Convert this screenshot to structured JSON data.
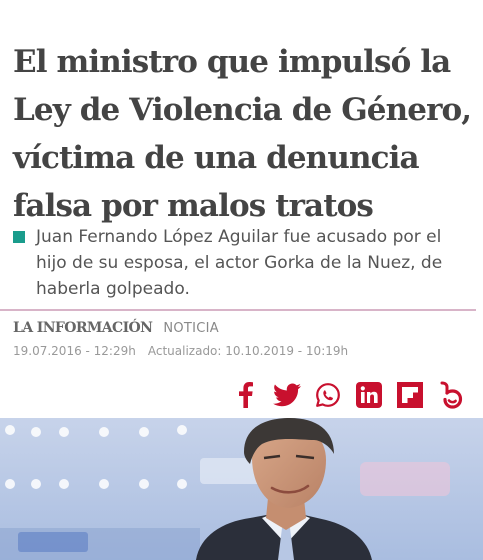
{
  "article": {
    "headline_lines": [
      "El ministro que impulsó la",
      "Ley de Violencia de Género,",
      "víctima de una denuncia",
      "falsa por malos tratos"
    ],
    "summary": "Juan Fernando López Aguilar fue acusado por el hijo de su esposa, el actor Gorka de la Nuez, de haberla golpeado.",
    "source": "LA INFORMACIÓN",
    "section": "NOTICIA",
    "published": "19.07.2016 - 12:29h",
    "updated": "Actualizado: 10.10.2019 - 10:19h"
  },
  "share": {
    "buttons": [
      {
        "name": "facebook",
        "icon": "facebook-icon"
      },
      {
        "name": "twitter",
        "icon": "twitter-icon"
      },
      {
        "name": "whatsapp",
        "icon": "whatsapp-icon"
      },
      {
        "name": "linkedin",
        "icon": "linkedin-icon"
      },
      {
        "name": "flipboard",
        "icon": "flipboard-icon"
      },
      {
        "name": "meneame",
        "icon": "meneame-icon"
      }
    ]
  },
  "colors": {
    "headline": "#444444",
    "accent": "#1a9c8c",
    "divider": "#d8b4c8",
    "share": "#c8102e",
    "photo_bg": "#b9c9e4"
  }
}
